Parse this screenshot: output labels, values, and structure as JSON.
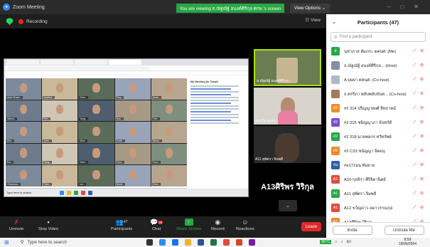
{
  "window": {
    "title": "Zoom Meeting"
  },
  "banner": {
    "share_text": "You are viewing ธ.ณัฐณัฐ์ อนงค์ศิริกุล.ศกษ.'s screen",
    "view_options": "View Options ⌄"
  },
  "meeting_bar": {
    "recording": "Recording",
    "view": "☷ View"
  },
  "shared_screen": {
    "chat_header": "My Meeting (to Tanat)",
    "bottom_left": "My Meeting (to Tanat) ⓦ",
    "taskbar_search": "Type here to search",
    "gallery_names": [
      "Anta Khaen...",
      "Kanitha...",
      "Som...",
      "Ploy...",
      "Anan...",
      "Wanid...",
      "Pim...",
      "Tong...",
      "Nok...",
      "Fah...",
      "Bee...",
      "Jane...",
      "Mint...",
      "Earth...",
      "Beam...",
      "Koi...",
      "Pang...",
      "Nam...",
      "Fern...",
      "Toon...",
      "Chompoo...",
      "Palm...",
      "Ice...",
      "Mook...",
      "Ohm..."
    ]
  },
  "speakers": [
    {
      "label": "ธ.ณัฐณัฐ์ อนงค์ศิริกุล..."
    },
    {
      "label": "สมถวิล สุนทร..."
    },
    {
      "label": "A11 สุพัตรา จิมพลี"
    }
  ],
  "active_speaker_name": "A13ศิริพร วิริกุล",
  "toolbar": {
    "unmute": "Unmute",
    "stop_video": "Stop Video",
    "participants": "Participants",
    "participants_count": "47",
    "chat": "Chat",
    "chat_badge": "39",
    "share": "Share Screen",
    "record": "Record",
    "reactions": "Reactions",
    "leave": "Leave"
  },
  "panel": {
    "title": "Participants (47)",
    "search_placeholder": "Find a participant",
    "invite": "Invite",
    "unmute_me": "Unmute Me",
    "participants": [
      {
        "initials": "ส",
        "color": "#27a844",
        "name": "นุชาภาส คัมภระ ตคนศ. (Me)"
      },
      {
        "initials": "",
        "color": "#7f8fa6",
        "name": "ธ.ณัฐณัฐ์ อนงค์ศิริกุล... (Host)"
      },
      {
        "initials": "",
        "color": "#b0b8c4",
        "name": "A บุษยา ตคนศ. (Co-host)"
      },
      {
        "initials": "",
        "color": "#a07c5c",
        "name": "ธ.ตรรีภา พลับพลับจันท... (Co-host)"
      },
      {
        "initials": "#2",
        "color": "#f08b2b",
        "name": "#2 314 ปริญญาพงศ์ สิทธาคม์"
      },
      {
        "initials": "#2",
        "color": "#7b4fc9",
        "name": "#2 316 ชนิญญาภา จันทร์ดี"
      },
      {
        "initials": "#2",
        "color": "#27a844",
        "name": "#2 318 นายพลกร ทวีทรัพย์"
      },
      {
        "initials": "#2",
        "color": "#f08b2b",
        "name": "#2 C33 ชนัญญา จิตอนุ"
      },
      {
        "initials": "#a",
        "color": "#2d5fa8",
        "name": "#a171มน ทัมยาย"
      },
      {
        "initials": "A1",
        "color": "#e04d3b",
        "name": "A10 กุลจิรา ศิริจิตานิตย์"
      },
      {
        "initials": "A1",
        "color": "#27a844",
        "name": "A11 สุพัตรา จิมพลี"
      },
      {
        "initials": "A1",
        "color": "#e04d3b",
        "name": "A12 ขวัญดาว ลดาวรรณกุล"
      },
      {
        "initials": "A1",
        "color": "#f08b2b",
        "name": "A13ศิริพร วิริกุล"
      }
    ]
  },
  "taskbar": {
    "search": "Type here to search",
    "weather": "30°C",
    "temp": "สุก",
    "time": "8:59",
    "date": "18/06/2564"
  },
  "colors": {
    "share_green": "#27a844",
    "leave_red": "#e02828",
    "active_border": "#a8e100"
  }
}
